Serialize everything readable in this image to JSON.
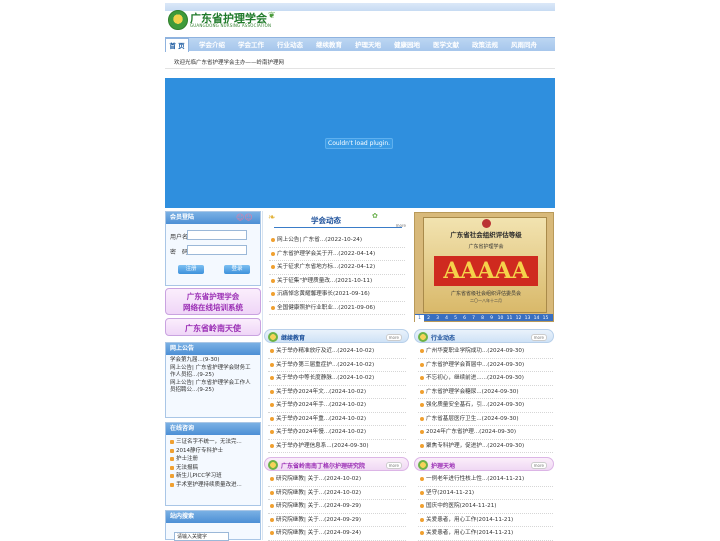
{
  "header": {
    "logo_cn": "广东省护理学会",
    "logo_en": "GUANGDONG NURSING ASSOCIATION"
  },
  "nav": {
    "items": [
      "首 页",
      "学会介绍",
      "学会工作",
      "行业动态",
      "继续教育",
      "护理天地",
      "健康园地",
      "医学文献",
      "政策法规",
      "风雨同舟"
    ],
    "active": 0
  },
  "welcome": "欢迎光临广东省护理学会主办——岭南护理网",
  "banner": {
    "message": "Couldn't load plugin."
  },
  "login": {
    "title": "会员登陆",
    "username_label": "用户名",
    "password_label": "密　码",
    "register_label": "注册",
    "login_label": "登录"
  },
  "promo": {
    "line1": "广东省护理学会",
    "line2": "网络在线培训系统",
    "tianshi": "广东省岭南天使"
  },
  "notice": {
    "title": "网上公告",
    "lines": [
      "学会第九届...(9-30)",
      "网上公告| 广东省护理学会财务工作人员招...(9-25)",
      "网上公告| 广东省护理学会工作人员招聘公...(9-25)"
    ]
  },
  "online": {
    "title": "在线咨询",
    "items": [
      "三证名字不统一，无法完...",
      "2014静疗专科护士",
      "护士注册",
      "无法报稿",
      "新生儿PICC学习班",
      "手术室护理持续质量改进..."
    ]
  },
  "search": {
    "title": "站内搜索",
    "placeholder": "请输入关键字"
  },
  "news": {
    "title": "学会动态",
    "more": "more",
    "items": [
      "网上公告| 广东省...(2022-10-24)",
      "广东省护理学会关于开...(2022-04-14)",
      "关于征求广东省地方标...(2022-04-12)",
      "关于征集\"护理质量改...(2021-10-11)",
      "沉痛悼念黄耀馨理事长(2021-09-16)",
      "全国健康照护行业职业...(2021-09-06)"
    ]
  },
  "photo": {
    "emblem_text": "广东省社会组织评估等级",
    "org": "广东省护理学会",
    "grade": "AAAAA",
    "issuer": "广东省省级社会组织评估委员会",
    "date": "二〇一八年十二月",
    "pages": [
      "1",
      "2",
      "3",
      "4",
      "5",
      "6",
      "7",
      "8",
      "9",
      "10",
      "11",
      "12",
      "13",
      "14",
      "15"
    ],
    "active_page": 0
  },
  "sections": {
    "edu": {
      "title": "继续教育",
      "more": "more",
      "items": [
        "关于举办精准放疗及近...(2024-10-02)",
        "关于举办第三届重症护...(2024-10-02)",
        "关于举办中等长度静脉...(2024-10-02)",
        "关于举办2024年文...(2024-10-02)",
        "关于举办2024年手...(2024-10-02)",
        "关于举办2024年重...(2024-10-02)",
        "关于举办2024年慢...(2024-10-02)",
        "关于举办护理信息系...(2024-09-30)"
      ]
    },
    "industry": {
      "title": "行业动态",
      "more": "more",
      "items": [
        "广州华夏职业学院成功...(2024-09-30)",
        "广东省护理学会首届中...(2024-09-30)",
        "不忘初心，继续前进......(2024-09-30)",
        "广东省护理学会糖尿...(2024-09-30)",
        "强化质量安全基石，引...(2024-09-30)",
        "广东省基层医疗卫生...(2024-09-30)",
        "2024年广东省护理...(2024-09-30)",
        "聚焦专科护理，促进护...(2024-09-30)"
      ]
    },
    "research": {
      "title": "广东省岭南南丁格尔护理研究院",
      "more": "more",
      "items": [
        "研究院继教| 关于...(2024-10-02)",
        "研究院继教| 关于...(2024-10-02)",
        "研究院继教| 关于...(2024-09-29)",
        "研究院继教| 关于...(2024-09-29)",
        "研究院继教| 关于...(2024-09-24)"
      ]
    },
    "care": {
      "title": "护理天地",
      "more": "more",
      "items": [
        "一例老年进行性核上性...(2014-11-21)",
        "坚守(2014-11-21)",
        "国庆中的医院(2014-11-21)",
        "关爱患者，用心工作(2014-11-21)",
        "关爱患者，用心工作(2014-11-21)"
      ]
    }
  }
}
